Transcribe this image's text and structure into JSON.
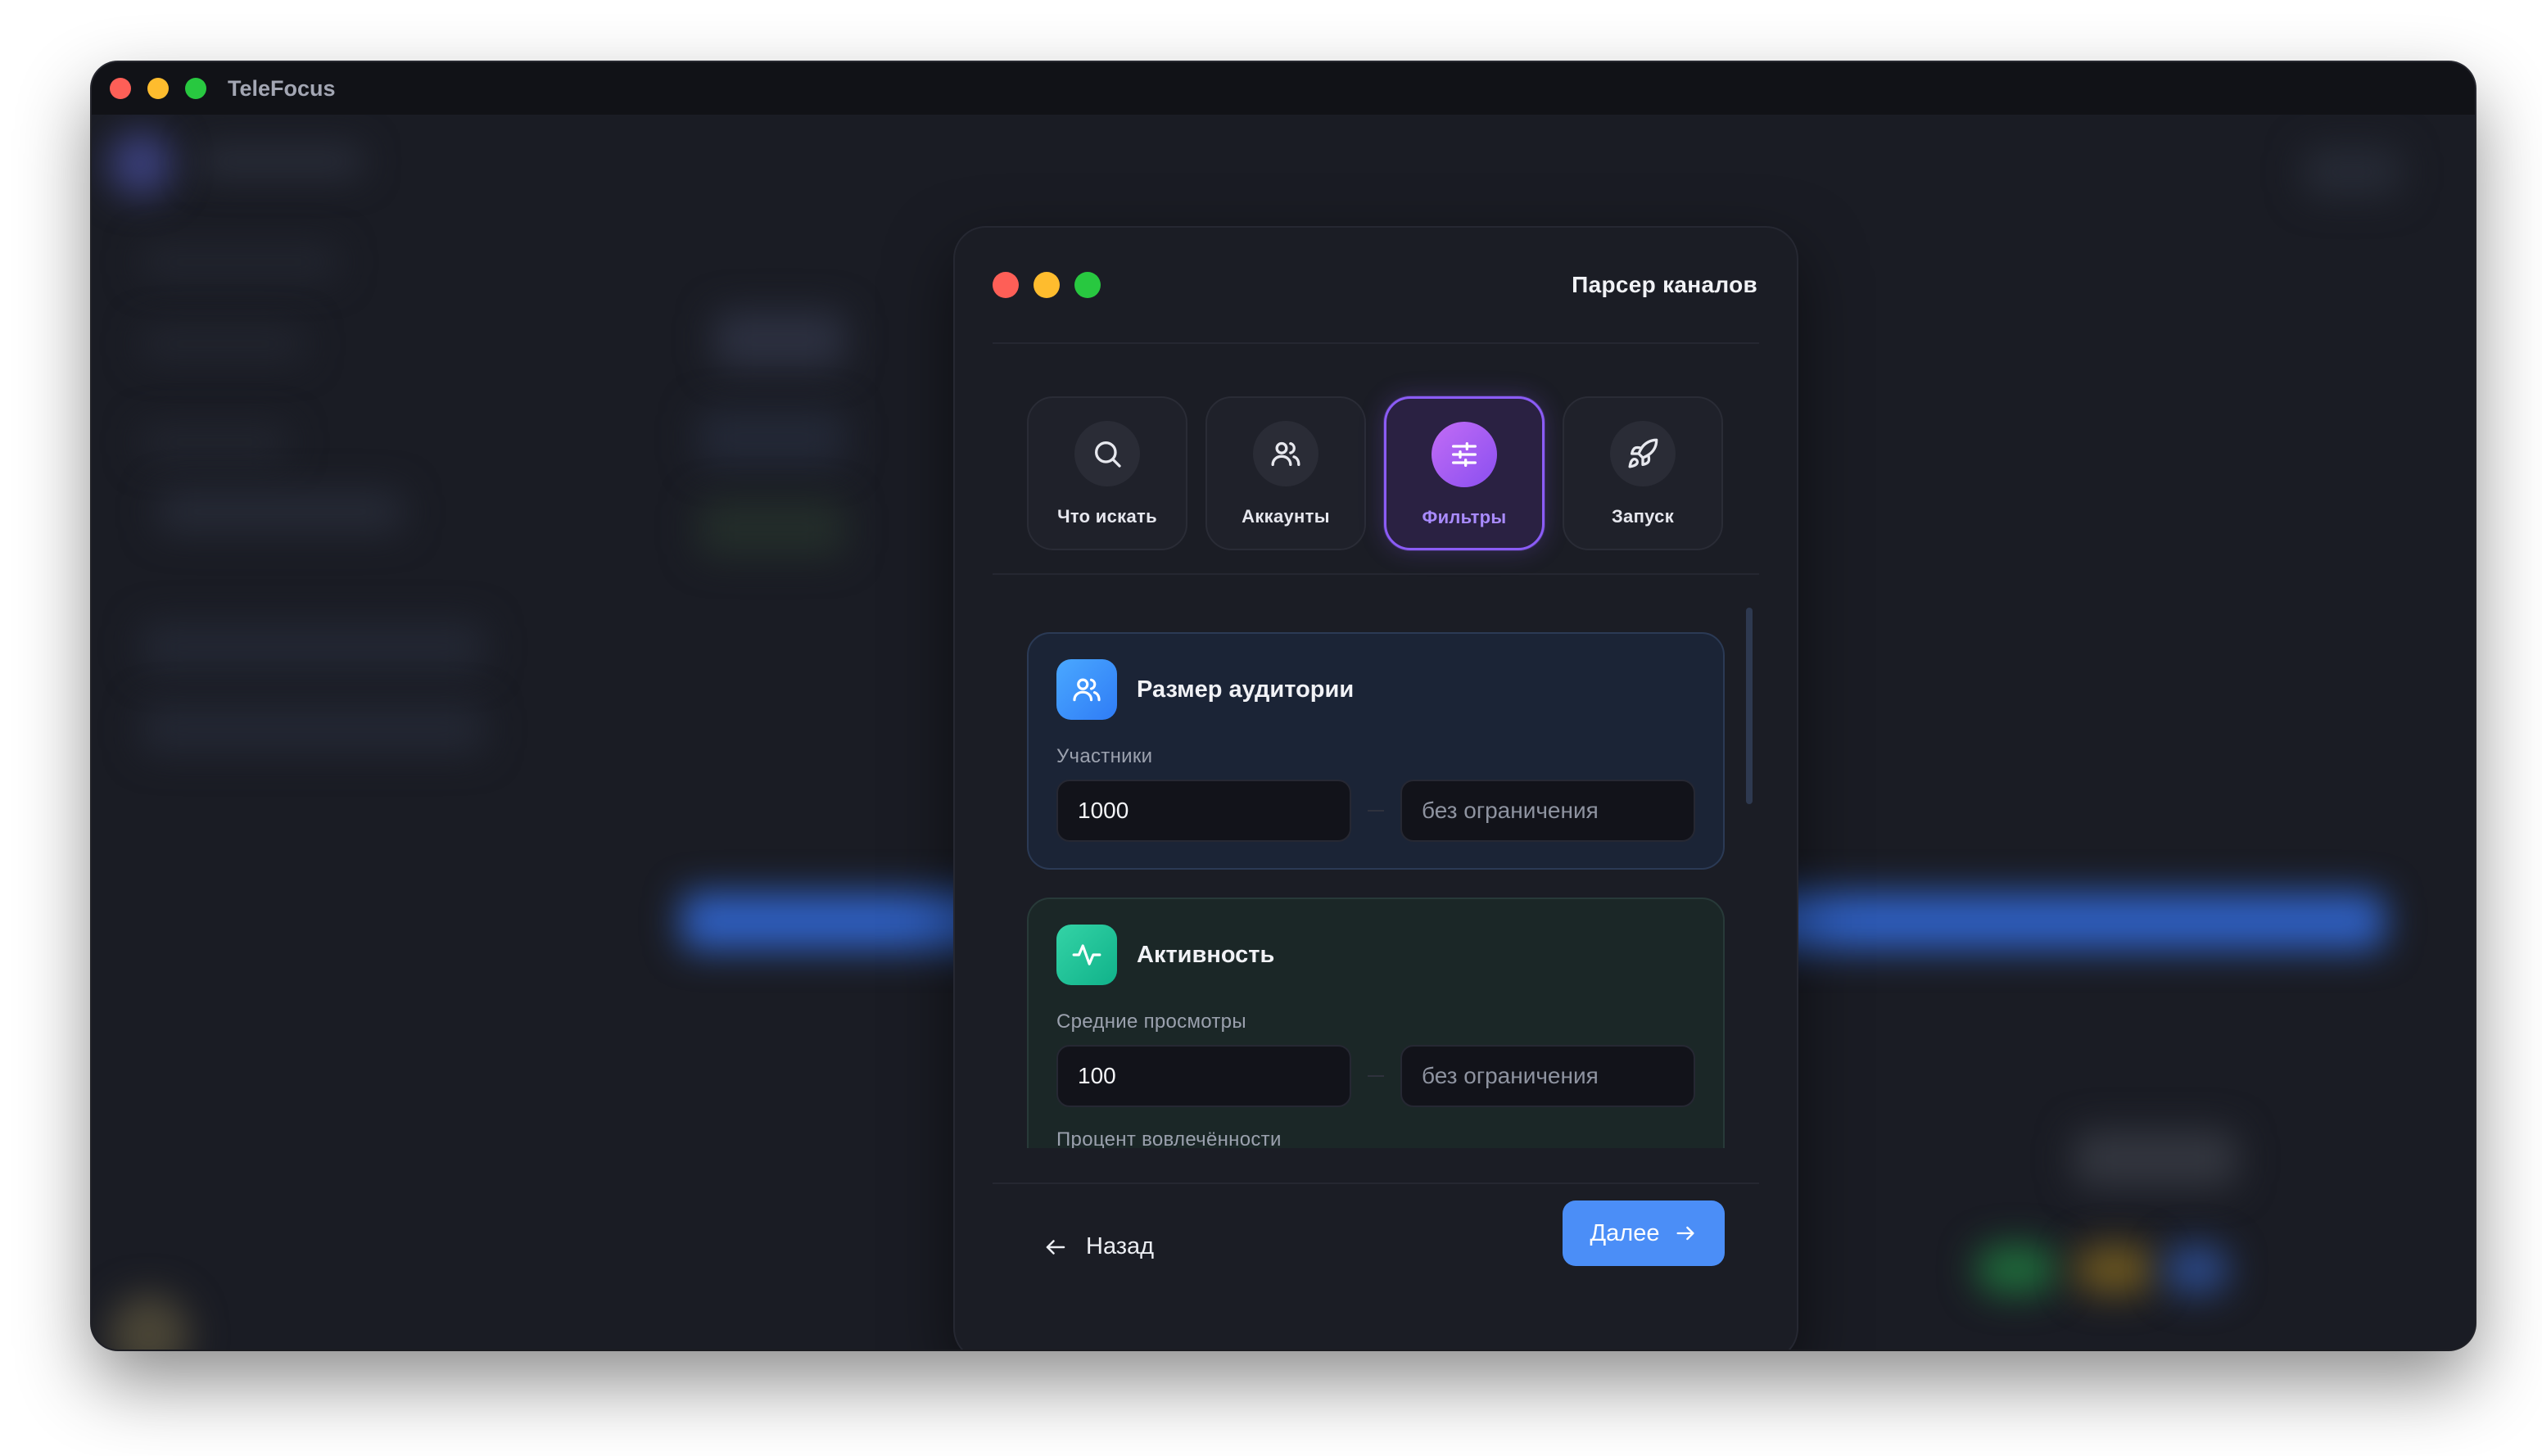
{
  "window": {
    "title": "TeleFocus"
  },
  "modal": {
    "title": "Парсер каналов"
  },
  "steps": [
    {
      "label": "Что искать",
      "icon": "search-icon",
      "active": false
    },
    {
      "label": "Аккаунты",
      "icon": "users-icon",
      "active": false
    },
    {
      "label": "Фильтры",
      "icon": "sliders-icon",
      "active": true
    },
    {
      "label": "Запуск",
      "icon": "rocket-icon",
      "active": false
    }
  ],
  "audience": {
    "title": "Размер аудитории",
    "icon": "users-icon",
    "field_label": "Участники",
    "min_value": "1000",
    "max_placeholder": "без ограничения"
  },
  "activity": {
    "title": "Активность",
    "icon": "activity-icon",
    "views_label": "Средние просмотры",
    "views_min_value": "100",
    "views_max_placeholder": "без ограничения",
    "engagement_label": "Процент вовлечённости"
  },
  "footer": {
    "back_label": "Назад",
    "next_label": "Далее"
  },
  "colors": {
    "accent": "#8b5cf6",
    "primary_button": "#4b8ef7",
    "audience_icon": "#3b8ef8",
    "activity_icon": "#1fc196"
  }
}
